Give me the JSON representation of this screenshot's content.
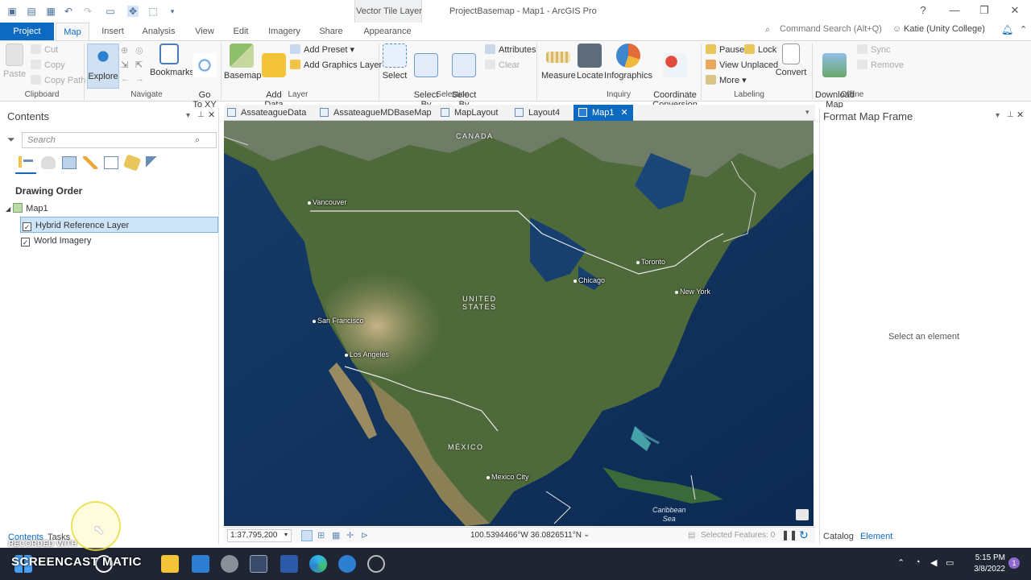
{
  "window": {
    "title": "ProjectBasemap - Map1 - ArcGIS Pro",
    "context_group": "Vector Tile Layer",
    "help": "?",
    "command_search_placeholder": "Command Search (Alt+Q)",
    "user": "Katie (Unity College)"
  },
  "ribbon_tabs": [
    "Project",
    "Map",
    "Insert",
    "Analysis",
    "View",
    "Edit",
    "Imagery",
    "Share",
    "Appearance"
  ],
  "ribbon": {
    "clipboard": {
      "label": "Clipboard",
      "paste": "Paste",
      "cut": "Cut",
      "copy": "Copy",
      "copy_path": "Copy Path"
    },
    "navigate": {
      "label": "Navigate",
      "explore": "Explore",
      "bookmarks": "Bookmarks",
      "go_to_xy": "Go\nTo XY"
    },
    "layer": {
      "label": "Layer",
      "basemap": "Basemap",
      "add_data": "Add\nData",
      "add_preset": "Add Preset",
      "add_graphics_layer": "Add Graphics Layer"
    },
    "selection": {
      "label": "Selection",
      "select": "Select",
      "select_by_attributes": "Select By\nAttributes",
      "select_by_location": "Select By\nLocation",
      "attributes": "Attributes",
      "clear": "Clear"
    },
    "inquiry": {
      "label": "Inquiry",
      "measure": "Measure",
      "locate": "Locate",
      "infographics": "Infographics",
      "coordinate_conversion": "Coordinate\nConversion"
    },
    "labeling": {
      "label": "Labeling",
      "pause": "Pause",
      "lock": "Lock",
      "view_unplaced": "View Unplaced",
      "more": "More",
      "convert": "Convert"
    },
    "offline": {
      "label": "Offline",
      "download_map": "Download\nMap",
      "sync": "Sync",
      "remove": "Remove"
    }
  },
  "contents": {
    "title": "Contents",
    "search_placeholder": "Search",
    "drawing_order": "Drawing Order",
    "map_name": "Map1",
    "layers": [
      {
        "name": "Hybrid Reference Layer",
        "checked": true,
        "selected": true
      },
      {
        "name": "World Imagery",
        "checked": true,
        "selected": false
      }
    ],
    "bottom_tabs": [
      "Contents",
      "Tasks"
    ]
  },
  "doc_tabs": [
    "AssateagueData",
    "AssateagueMDBaseMap",
    "MapLayout",
    "Layout4",
    "Map1"
  ],
  "map": {
    "countries": [
      "CANADA",
      "UNITED\nSTATES",
      "MÉXICO"
    ],
    "cities": [
      "Vancouver",
      "Toronto",
      "Chicago",
      "New York",
      "San Francisco",
      "Los Angeles",
      "Mexico City"
    ],
    "sea_label": "Caribbean\nSea"
  },
  "map_status": {
    "scale": "1:37,795,200",
    "coordinates": "100.5394466°W 36.0826511°N",
    "selected_features": "Selected Features: 0"
  },
  "format_pane": {
    "title": "Format Map Frame",
    "message": "Select an element",
    "bottom_tabs": [
      "Catalog",
      "Element"
    ]
  },
  "taskbar": {
    "time": "5:15 PM",
    "date": "3/8/2022"
  },
  "watermark": {
    "line1": "RECORDED WITH",
    "line2": "SCREENCAST  MATIC"
  }
}
